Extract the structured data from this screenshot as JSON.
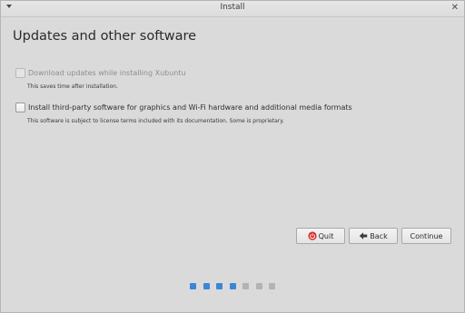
{
  "window": {
    "title": "Install"
  },
  "page": {
    "heading": "Updates and other software"
  },
  "options": [
    {
      "label": "Download updates while installing Xubuntu",
      "description": "This saves time after installation.",
      "checked": false,
      "disabled": true
    },
    {
      "label": "Install third-party software for graphics and Wi-Fi hardware and additional media formats",
      "description": "This software is subject to license terms included with its documentation. Some is proprietary.",
      "checked": false,
      "disabled": false
    }
  ],
  "buttons": {
    "quit": "Quit",
    "back": "Back",
    "continue": "Continue"
  },
  "progress": {
    "total_steps": 7,
    "completed_steps": 4,
    "active_color": "#3d86d6",
    "inactive_color": "#b3b3b3"
  },
  "icons": {
    "quit": "power-icon",
    "back": "arrow-left-icon",
    "menu": "chevron-down-icon",
    "close": "close-icon"
  }
}
